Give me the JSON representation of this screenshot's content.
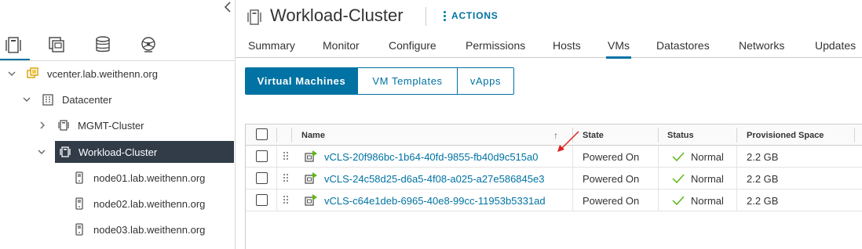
{
  "navigator": {
    "icons": [
      {
        "name": "hosts-clusters-icon",
        "active": true
      },
      {
        "name": "vms-templates-icon",
        "active": false
      },
      {
        "name": "storage-icon",
        "active": false
      },
      {
        "name": "networking-icon",
        "active": false
      }
    ],
    "tree": [
      {
        "label": "vcenter.lab.weithenn.org",
        "icon": "vcenter-icon",
        "expanded": true
      },
      {
        "label": "Datacenter",
        "icon": "datacenter-icon",
        "expanded": true
      },
      {
        "label": "MGMT-Cluster",
        "icon": "cluster-icon",
        "expanded": false
      },
      {
        "label": "Workload-Cluster",
        "icon": "cluster-icon",
        "expanded": true,
        "selected": true
      },
      {
        "label": "node01.lab.weithenn.org",
        "icon": "host-icon"
      },
      {
        "label": "node02.lab.weithenn.org",
        "icon": "host-icon"
      },
      {
        "label": "node03.lab.weithenn.org",
        "icon": "host-icon"
      }
    ]
  },
  "header": {
    "title": "Workload-Cluster",
    "actions_label": "ACTIONS"
  },
  "tabs": [
    {
      "label": "Summary",
      "active": false
    },
    {
      "label": "Monitor",
      "active": false
    },
    {
      "label": "Configure",
      "active": false
    },
    {
      "label": "Permissions",
      "active": false
    },
    {
      "label": "Hosts",
      "active": false
    },
    {
      "label": "VMs",
      "active": true
    },
    {
      "label": "Datastores",
      "active": false
    },
    {
      "label": "Networks",
      "active": false
    },
    {
      "label": "Updates",
      "active": false
    }
  ],
  "subtabs": [
    {
      "label": "Virtual Machines",
      "active": true
    },
    {
      "label": "VM Templates",
      "active": false
    },
    {
      "label": "vApps",
      "active": false
    }
  ],
  "grid": {
    "columns": [
      "Name",
      "State",
      "Status",
      "Provisioned Space"
    ],
    "sort_indicator": "↑",
    "rows": [
      {
        "name": "vCLS-20f986bc-1b64-40fd-9855-fb40d9c515a0",
        "state": "Powered On",
        "status": "Normal",
        "provisioned": "2.2 GB"
      },
      {
        "name": "vCLS-24c58d25-d6a5-4f08-a025-a27e586845e3",
        "state": "Powered On",
        "status": "Normal",
        "provisioned": "2.2 GB"
      },
      {
        "name": "vCLS-c64e1deb-6965-40e8-99cc-11953b5331ad",
        "state": "Powered On",
        "status": "Normal",
        "provisioned": "2.2 GB"
      }
    ]
  },
  "colors": {
    "accent": "#0072a3",
    "selected_bg": "#313c48",
    "status_ok": "#5eb715",
    "annotation_arrow": "#e02020"
  }
}
